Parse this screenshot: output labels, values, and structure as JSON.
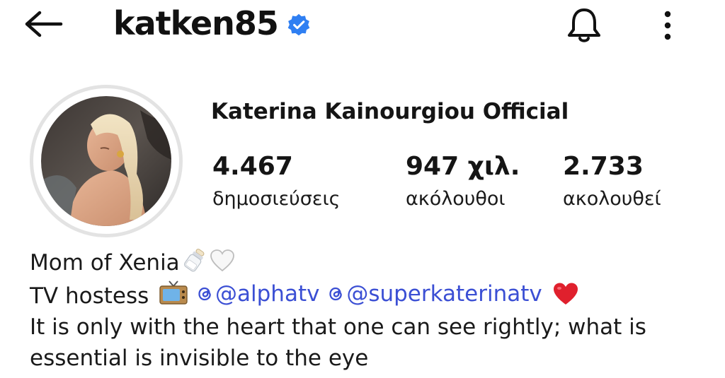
{
  "header": {
    "username": "katken85",
    "verified": true,
    "verified_color": "#2f7ff2",
    "back_icon": "arrow-left-icon",
    "bell_icon": "bell-icon",
    "more_icon": "more-vertical-icon"
  },
  "profile": {
    "display_name": "Katerina Kainourgiou Official",
    "stats": {
      "posts": {
        "count": "4.467",
        "label": "δημοσιεύσεις"
      },
      "followers": {
        "count": "947 χιλ.",
        "label": "ακόλουθοι"
      },
      "following": {
        "count": "2.733",
        "label": "ακολουθεί"
      }
    }
  },
  "bio": {
    "line1": "Mom of Xenia",
    "line1_emojis": [
      "baby-bottle-icon",
      "white-heart-icon"
    ],
    "line2_prefix": "TV hostess",
    "line2_emoji": "television-icon",
    "mentions": [
      "@alphatv",
      "@superkaterinatv"
    ],
    "line2_suffix_emoji": "red-heart-icon",
    "quote": "It is only with the heart that one can see rightly; what is essential is invisible to the eye"
  },
  "colors": {
    "mention": "#3b4fd4",
    "avatar_ring": "#e3e3e3",
    "heart_red": "#e0202d"
  }
}
